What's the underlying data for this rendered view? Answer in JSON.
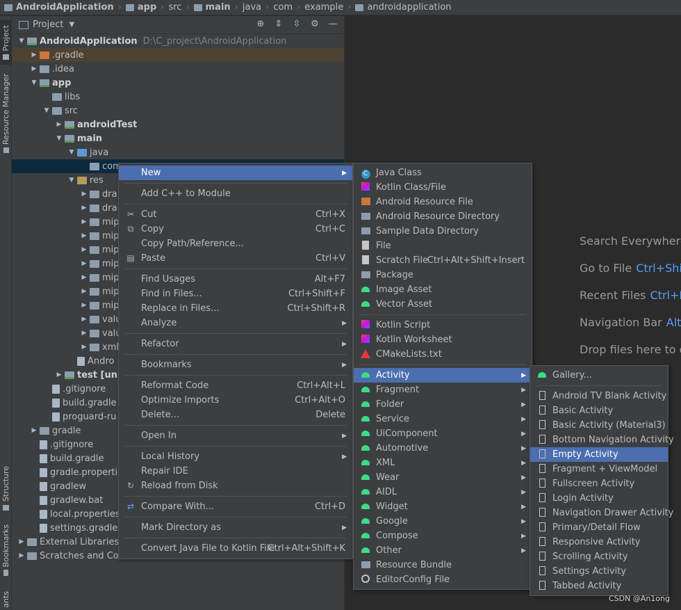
{
  "breadcrumb": [
    "AndroidApplication",
    "app",
    "src",
    "main",
    "java",
    "com",
    "example",
    "androidapplication"
  ],
  "tool_stripe": {
    "project": "Project",
    "resource_manager": "Resource Manager",
    "structure": "Structure",
    "bookmarks": "Bookmarks",
    "variants": "ants"
  },
  "project_panel": {
    "title": "Project",
    "tree": [
      {
        "label": "AndroidApplication",
        "path": "D:\\C_project\\AndroidApplication"
      },
      {
        "label": ".gradle"
      },
      {
        "label": ".idea"
      },
      {
        "label": "app"
      },
      {
        "label": "libs"
      },
      {
        "label": "src"
      },
      {
        "label": "androidTest"
      },
      {
        "label": "main"
      },
      {
        "label": "java"
      },
      {
        "label": "com"
      },
      {
        "label": "res"
      },
      {
        "label": "dra"
      },
      {
        "label": "dra"
      },
      {
        "label": "mip"
      },
      {
        "label": "mip"
      },
      {
        "label": "mip"
      },
      {
        "label": "mip"
      },
      {
        "label": "mip"
      },
      {
        "label": "mip"
      },
      {
        "label": "mip"
      },
      {
        "label": "valu"
      },
      {
        "label": "valu"
      },
      {
        "label": "xml"
      },
      {
        "label": "Andro"
      },
      {
        "label": "test [unit"
      },
      {
        "label": ".gitignore"
      },
      {
        "label": "build.gradle"
      },
      {
        "label": "proguard-ru"
      },
      {
        "label": "gradle"
      },
      {
        "label": ".gitignore"
      },
      {
        "label": "build.gradle"
      },
      {
        "label": "gradle.propertie"
      },
      {
        "label": "gradlew"
      },
      {
        "label": "gradlew.bat"
      },
      {
        "label": "local.properties"
      },
      {
        "label": "settings.gradle"
      },
      {
        "label": "External Libraries"
      },
      {
        "label": "Scratches and Con"
      }
    ]
  },
  "editor_hints": [
    {
      "label": "Search Everywhere",
      "key": ""
    },
    {
      "label": "Go to File",
      "key": "Ctrl+Shi"
    },
    {
      "label": "Recent Files",
      "key": "Ctrl+E"
    },
    {
      "label": "Navigation Bar",
      "key": "Alt"
    },
    {
      "label": "Drop files here to o",
      "key": ""
    }
  ],
  "context_menu": [
    {
      "label": "New",
      "shortcut": "",
      "submenu": true,
      "icon": ""
    },
    {
      "label": "Add C++ to Module",
      "shortcut": "",
      "submenu": false,
      "icon": ""
    },
    {
      "label": "Cut",
      "shortcut": "Ctrl+X",
      "submenu": false,
      "icon": "scissors-icon"
    },
    {
      "label": "Copy",
      "shortcut": "Ctrl+C",
      "submenu": false,
      "icon": "copy-icon"
    },
    {
      "label": "Copy Path/Reference...",
      "shortcut": "",
      "submenu": false,
      "icon": ""
    },
    {
      "label": "Paste",
      "shortcut": "Ctrl+V",
      "submenu": false,
      "icon": "clipboard-icon"
    },
    {
      "label": "Find Usages",
      "shortcut": "Alt+F7",
      "submenu": false,
      "icon": ""
    },
    {
      "label": "Find in Files...",
      "shortcut": "Ctrl+Shift+F",
      "submenu": false,
      "icon": ""
    },
    {
      "label": "Replace in Files...",
      "shortcut": "Ctrl+Shift+R",
      "submenu": false,
      "icon": ""
    },
    {
      "label": "Analyze",
      "shortcut": "",
      "submenu": true,
      "icon": ""
    },
    {
      "label": "Refactor",
      "shortcut": "",
      "submenu": true,
      "icon": ""
    },
    {
      "label": "Bookmarks",
      "shortcut": "",
      "submenu": true,
      "icon": ""
    },
    {
      "label": "Reformat Code",
      "shortcut": "Ctrl+Alt+L",
      "submenu": false,
      "icon": ""
    },
    {
      "label": "Optimize Imports",
      "shortcut": "Ctrl+Alt+O",
      "submenu": false,
      "icon": ""
    },
    {
      "label": "Delete...",
      "shortcut": "Delete",
      "submenu": false,
      "icon": ""
    },
    {
      "label": "Open In",
      "shortcut": "",
      "submenu": true,
      "icon": ""
    },
    {
      "label": "Local History",
      "shortcut": "",
      "submenu": true,
      "icon": ""
    },
    {
      "label": "Repair IDE",
      "shortcut": "",
      "submenu": false,
      "icon": ""
    },
    {
      "label": "Reload from Disk",
      "shortcut": "",
      "submenu": false,
      "icon": "reload-icon"
    },
    {
      "label": "Compare With...",
      "shortcut": "Ctrl+D",
      "submenu": false,
      "icon": "compare-icon"
    },
    {
      "label": "Mark Directory as",
      "shortcut": "",
      "submenu": true,
      "icon": ""
    },
    {
      "label": "Convert Java File to Kotlin File",
      "shortcut": "Ctrl+Alt+Shift+K",
      "submenu": false,
      "icon": ""
    }
  ],
  "new_menu": [
    {
      "label": "Java Class",
      "icon": "java-class-icon",
      "shortcut": "",
      "submenu": false
    },
    {
      "label": "Kotlin Class/File",
      "icon": "kotlin-file-icon",
      "shortcut": "",
      "submenu": false
    },
    {
      "label": "Android Resource File",
      "icon": "android-resource-file-icon",
      "shortcut": "",
      "submenu": false
    },
    {
      "label": "Android Resource Directory",
      "icon": "folder-icon",
      "shortcut": "",
      "submenu": false
    },
    {
      "label": "Sample Data Directory",
      "icon": "folder-icon",
      "shortcut": "",
      "submenu": false
    },
    {
      "label": "File",
      "icon": "file-icon",
      "shortcut": "",
      "submenu": false
    },
    {
      "label": "Scratch File",
      "icon": "scratch-file-icon",
      "shortcut": "Ctrl+Alt+Shift+Insert",
      "submenu": false
    },
    {
      "label": "Package",
      "icon": "folder-icon",
      "shortcut": "",
      "submenu": false
    },
    {
      "label": "Image Asset",
      "icon": "android-icon",
      "shortcut": "",
      "submenu": false
    },
    {
      "label": "Vector Asset",
      "icon": "android-icon",
      "shortcut": "",
      "submenu": false
    },
    {
      "label": "Kotlin Script",
      "icon": "kotlin-script-icon",
      "shortcut": "",
      "submenu": false
    },
    {
      "label": "Kotlin Worksheet",
      "icon": "kotlin-worksheet-icon",
      "shortcut": "",
      "submenu": false
    },
    {
      "label": "CMakeLists.txt",
      "icon": "cmake-icon",
      "shortcut": "",
      "submenu": false
    },
    {
      "label": "Activity",
      "icon": "android-icon",
      "shortcut": "",
      "submenu": true
    },
    {
      "label": "Fragment",
      "icon": "android-icon",
      "shortcut": "",
      "submenu": true
    },
    {
      "label": "Folder",
      "icon": "android-icon",
      "shortcut": "",
      "submenu": true
    },
    {
      "label": "Service",
      "icon": "android-icon",
      "shortcut": "",
      "submenu": true
    },
    {
      "label": "UiComponent",
      "icon": "android-icon",
      "shortcut": "",
      "submenu": true
    },
    {
      "label": "Automotive",
      "icon": "android-icon",
      "shortcut": "",
      "submenu": true
    },
    {
      "label": "XML",
      "icon": "android-icon",
      "shortcut": "",
      "submenu": true
    },
    {
      "label": "Wear",
      "icon": "android-icon",
      "shortcut": "",
      "submenu": true
    },
    {
      "label": "AIDL",
      "icon": "android-icon",
      "shortcut": "",
      "submenu": true
    },
    {
      "label": "Widget",
      "icon": "android-icon",
      "shortcut": "",
      "submenu": true
    },
    {
      "label": "Google",
      "icon": "android-icon",
      "shortcut": "",
      "submenu": true
    },
    {
      "label": "Compose",
      "icon": "android-icon",
      "shortcut": "",
      "submenu": true
    },
    {
      "label": "Other",
      "icon": "android-icon",
      "shortcut": "",
      "submenu": true
    },
    {
      "label": "Resource Bundle",
      "icon": "resource-bundle-icon",
      "shortcut": "",
      "submenu": false
    },
    {
      "label": "EditorConfig File",
      "icon": "editorconfig-icon",
      "shortcut": "",
      "submenu": false
    }
  ],
  "activity_menu": [
    {
      "label": "Gallery...",
      "icon": "android-icon"
    },
    {
      "label": "Android TV Blank Activity",
      "icon": "page-icon"
    },
    {
      "label": "Basic Activity",
      "icon": "page-icon"
    },
    {
      "label": "Basic Activity (Material3)",
      "icon": "page-icon"
    },
    {
      "label": "Bottom Navigation Activity",
      "icon": "page-icon"
    },
    {
      "label": "Empty Activity",
      "icon": "page-icon"
    },
    {
      "label": "Fragment + ViewModel",
      "icon": "page-icon"
    },
    {
      "label": "Fullscreen Activity",
      "icon": "page-icon"
    },
    {
      "label": "Login Activity",
      "icon": "page-icon"
    },
    {
      "label": "Navigation Drawer Activity",
      "icon": "page-icon"
    },
    {
      "label": "Primary/Detail Flow",
      "icon": "page-icon"
    },
    {
      "label": "Responsive Activity",
      "icon": "page-icon"
    },
    {
      "label": "Scrolling Activity",
      "icon": "page-icon"
    },
    {
      "label": "Settings Activity",
      "icon": "page-icon"
    },
    {
      "label": "Tabbed Activity",
      "icon": "page-icon"
    }
  ],
  "watermark": "CSDN @An1ong",
  "colors": {
    "highlight": "#4b6eaf",
    "android_green": "#3ddc84",
    "link_blue": "#589df6"
  }
}
